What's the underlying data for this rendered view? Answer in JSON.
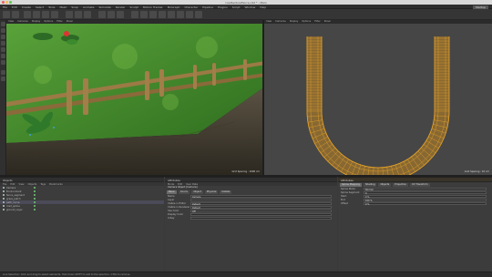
{
  "window": {
    "title": "roadtextureFence.c4d * - Main"
  },
  "menubar": {
    "items": [
      "File",
      "Edit",
      "Create",
      "Select",
      "Tools",
      "Mesh",
      "Snap",
      "Animate",
      "Simulate",
      "Render",
      "Sculpt",
      "Motion Tracker",
      "MoGraph",
      "Character",
      "Pipeline",
      "Plugins",
      "Script",
      "Window",
      "Help"
    ],
    "layout": "Startup"
  },
  "viewport_left": {
    "menu": [
      "View",
      "Cameras",
      "Display",
      "Options",
      "Filter",
      "Panel"
    ],
    "footer": "Grid Spacing : 1000 cm"
  },
  "viewport_right": {
    "menu": [
      "View",
      "Cameras",
      "Display",
      "Options",
      "Filter",
      "Panel"
    ],
    "footer": "Grid Spacing : 10 cm"
  },
  "objects_panel": {
    "title": "Objects",
    "menu": [
      "File",
      "Edit",
      "View",
      "Objects",
      "Tags",
      "Bookmarks"
    ],
    "rows": [
      "Camera",
      "Environment",
      "fence_segment",
      "grass_patch",
      "path_curve",
      "road_spline",
      "ground_Layer"
    ]
  },
  "attributes_panel": {
    "title": "Attributes",
    "menu": [
      "Mode",
      "Edit",
      "User Data"
    ],
    "object_label": "Camera Object [Camera]",
    "tabs": [
      "Basic",
      "Coord.",
      "Object",
      "Physical",
      "Details"
    ],
    "rows": [
      {
        "label": "Name",
        "value": "Camera"
      },
      {
        "label": "Layer",
        "value": ""
      },
      {
        "label": "Visible in Editor",
        "value": "Default"
      },
      {
        "label": "Visible in Renderer",
        "value": "Default"
      },
      {
        "label": "Use Color",
        "value": "Off"
      },
      {
        "label": "Display Color",
        "value": ""
      },
      {
        "label": "X-Ray",
        "value": ""
      }
    ]
  },
  "tags_panel": {
    "title": "Attributes",
    "tabs": [
      "Spline Mapping",
      "Shading",
      "Objects",
      "Projection",
      "UV Transform"
    ],
    "rows": [
      {
        "label": "Spline Mode",
        "value": "Normal"
      },
      {
        "label": "Spline Segment",
        "value": "0"
      },
      {
        "label": "Start",
        "value": "0 %"
      },
      {
        "label": "End",
        "value": "100 %"
      },
      {
        "label": "Offset",
        "value": "0 %"
      }
    ]
  },
  "statusbar": {
    "text": "Live Selection: Click and drag to select elements. Hold down SHIFT to add to the selection, CTRL to remove."
  },
  "colors": {
    "grass": "#3f8a2a",
    "dirt": "#4a4235",
    "wood": "#8a6a3a",
    "spline": "#e8a428",
    "accent": "#d96a2a"
  }
}
